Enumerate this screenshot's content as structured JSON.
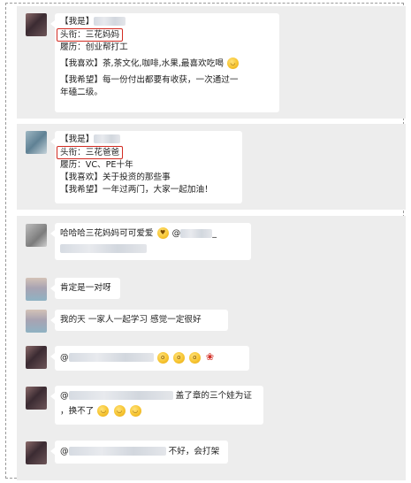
{
  "post1": {
    "label_name": "【我是】",
    "title_line": "头衔：三花妈妈",
    "resume": "履历：创业帮打工",
    "like_label": "【我喜欢】",
    "like_text": "茶,茶文化,咖啡,水果,最喜欢吃喝",
    "hope_label": "【我希望】",
    "hope_line1": "每一份付出都要有收获，一次通过一",
    "hope_line2": "年磕二级。",
    "emoji": "grinning-emoji"
  },
  "post2": {
    "label_name": "【我是】",
    "title_line": "头衔：三花爸爸",
    "resume": "履历：VC、PE十年",
    "like_label": "【我喜欢】",
    "like_text": "关于投资的那些事",
    "hope_label": "【我希望】",
    "hope_text": "一年过两门，大家一起加油！"
  },
  "comments": [
    {
      "text": "哈哈哈三花妈妈可可爱爱",
      "at": "@",
      "suffix": "_"
    },
    {
      "text": "肯定是一对呀"
    },
    {
      "text": "我的天 一家人一起学习 感觉一定很好"
    },
    {
      "at": "@"
    },
    {
      "at": "@",
      "text": "盖了章的三个娃为证",
      "text2": "，换不了"
    },
    {
      "at": "@",
      "text": "不好，会打架"
    }
  ],
  "accent_red": "#d22b22"
}
